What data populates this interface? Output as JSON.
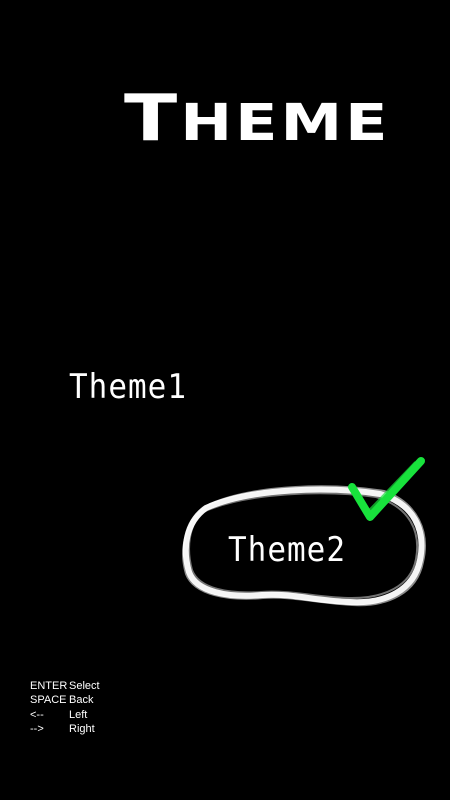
{
  "screen": {
    "title": "Theme",
    "background": "#000000",
    "text_color": "#ffffff"
  },
  "options": [
    {
      "label": "Theme1",
      "selected": false
    },
    {
      "label": "Theme2",
      "selected": true
    }
  ],
  "selection": {
    "highlight_icon": "chalk-circle-outline",
    "check_icon": "green-checkmark-icon",
    "check_color": "#18e23c",
    "circle_color": "#ffffff"
  },
  "controls": [
    {
      "key": "ENTER",
      "action": "Select"
    },
    {
      "key": "SPACE",
      "action": "Back"
    },
    {
      "key": "<--",
      "action": "Left"
    },
    {
      "key": "-->",
      "action": "Right"
    }
  ]
}
